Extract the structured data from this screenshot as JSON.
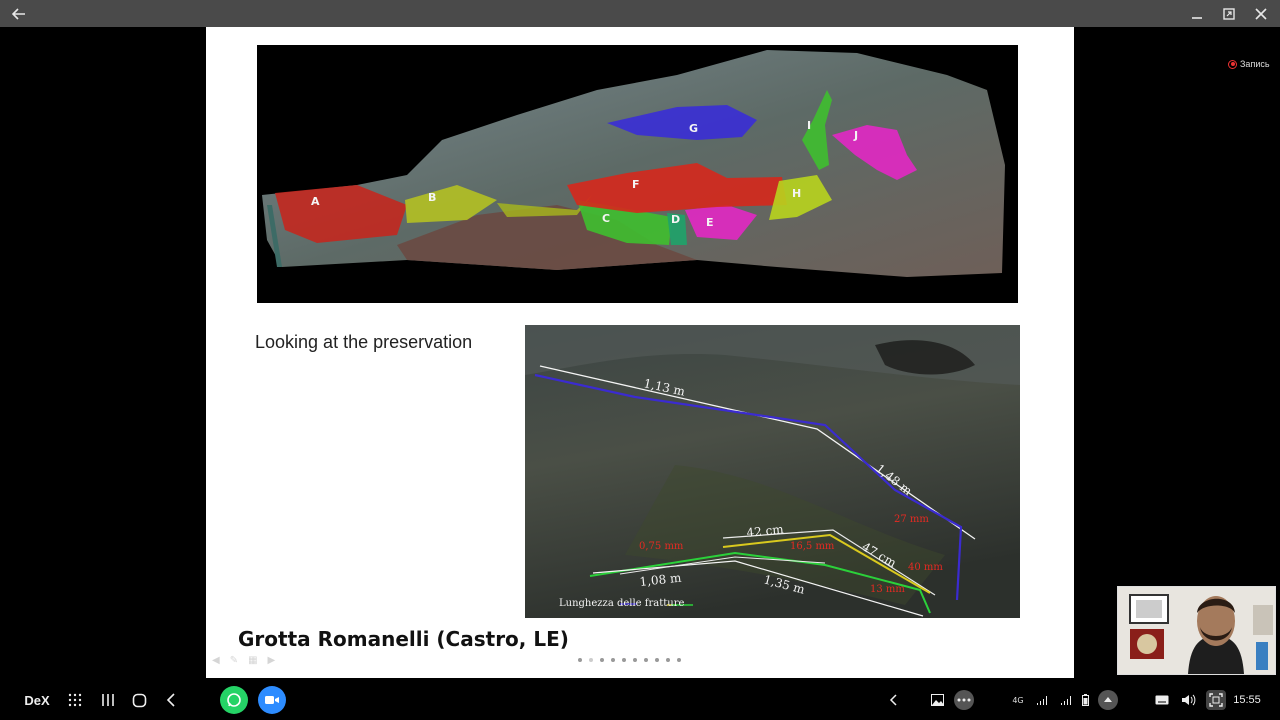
{
  "window": {
    "back_icon": "arrow-left-icon",
    "minimize_icon": "minimize-icon",
    "maximize_icon": "maximize-icon",
    "close_icon": "close-icon"
  },
  "recording": {
    "label": "Запись",
    "color": "#e33333"
  },
  "slide": {
    "text": "Looking at the preservation",
    "title": "Grotta Romanelli (Castro, LE)",
    "top_photo_labels": [
      "A",
      "B",
      "C",
      "D",
      "E",
      "F",
      "G",
      "H",
      "I",
      "J"
    ],
    "bottom_photo": {
      "measure_white": [
        "1,13 m",
        "1,48 m",
        "42 cm",
        "47 cm",
        "1,08 m",
        "1,35 m"
      ],
      "measure_red": [
        "27 mm",
        "0,75 mm",
        "16,5 mm",
        "40 mm",
        "13 mm"
      ],
      "caption": "Lunghezza delle fratture"
    },
    "page_dots": 10,
    "active_dot": 1
  },
  "taskbar": {
    "dex_label": "DeX",
    "network_label": "4G",
    "time": "15:55",
    "apps": [
      "whatsapp-icon",
      "zoom-icon"
    ]
  }
}
